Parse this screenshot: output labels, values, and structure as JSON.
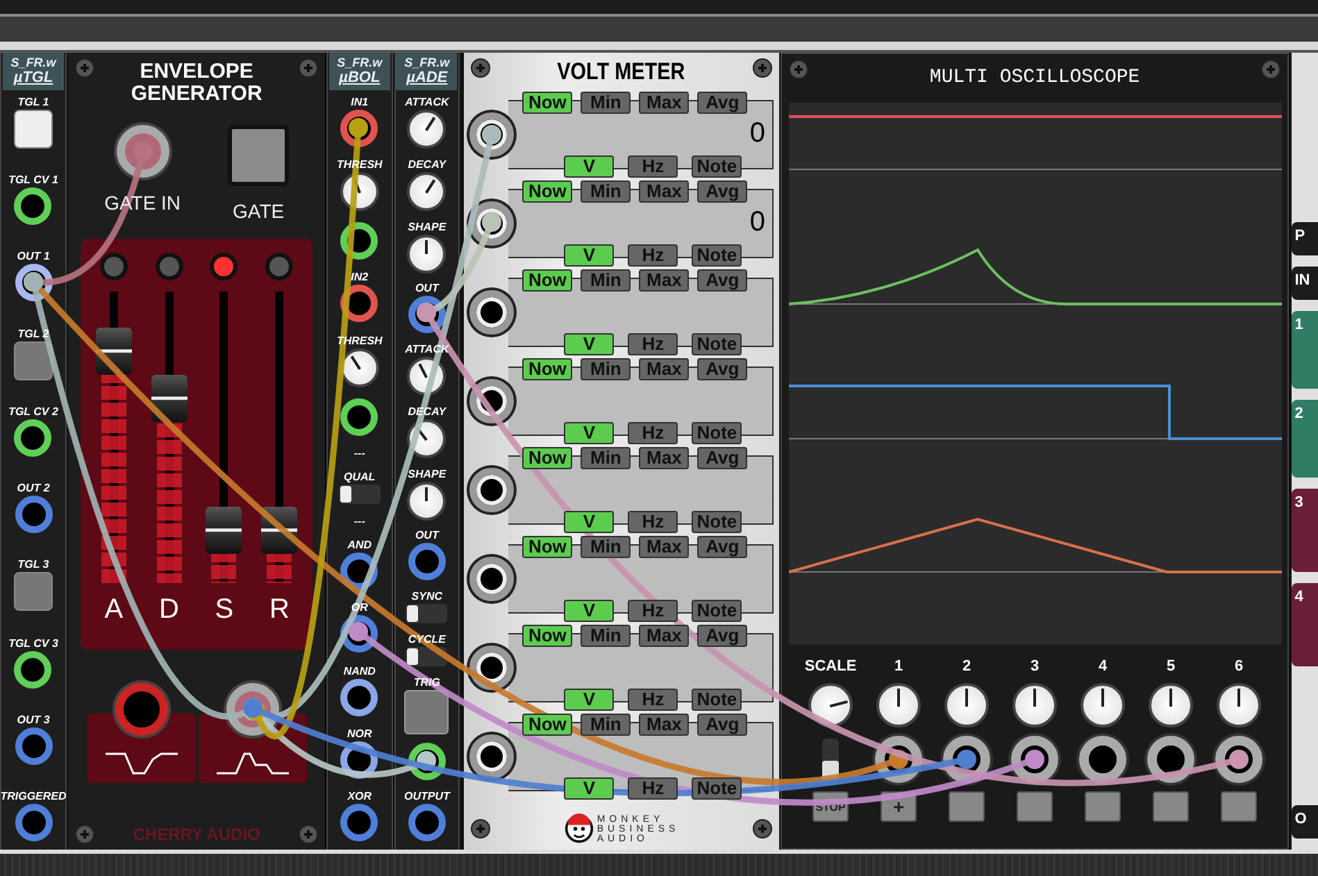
{
  "utgl": {
    "brand": "S_FR.w",
    "name": "µTGL",
    "items": [
      {
        "label": "TGL 1",
        "kind": "toggle",
        "on": true
      },
      {
        "label": "TGL CV 1",
        "kind": "jack",
        "color": "#5fcf57"
      },
      {
        "label": "OUT 1",
        "kind": "jack",
        "color": "#a9b8ef"
      },
      {
        "label": "TGL 2",
        "kind": "toggle",
        "on": false
      },
      {
        "label": "TGL CV 2",
        "kind": "jack",
        "color": "#5fcf57"
      },
      {
        "label": "OUT 2",
        "kind": "jack",
        "color": "#4f7fd9"
      },
      {
        "label": "TGL 3",
        "kind": "toggle",
        "on": false
      },
      {
        "label": "TGL CV 3",
        "kind": "jack",
        "color": "#5fcf57"
      },
      {
        "label": "OUT 3",
        "kind": "jack",
        "color": "#4f7fd9"
      },
      {
        "label": "TRIGGERED",
        "kind": "jack",
        "color": "#4f7fd9"
      }
    ]
  },
  "envelope": {
    "title": "ENVELOPE GENERATOR",
    "gate_in": "GATE IN",
    "gate": "GATE",
    "brand": "CHERRY AUDIO",
    "faders": [
      {
        "label": "A",
        "level": 0.85,
        "lit": false
      },
      {
        "label": "D",
        "level": 0.66,
        "lit": false
      },
      {
        "label": "S",
        "level": 0.12,
        "lit": true
      },
      {
        "label": "R",
        "level": 0.12,
        "lit": false
      }
    ]
  },
  "ubol": {
    "brand": "S_FR.w",
    "name": "µBOL",
    "items": [
      {
        "label": "IN1",
        "kind": "jack",
        "color": "#e0544e"
      },
      {
        "label": "THRESH",
        "kind": "knob",
        "level": 0.42
      },
      {
        "kind": "jack",
        "color": "#5fcf57"
      },
      {
        "label": "IN2",
        "kind": "jack",
        "color": "#e0544e"
      },
      {
        "label": "THRESH",
        "kind": "knob",
        "level": 0.38
      },
      {
        "kind": "jack",
        "color": "#5fcf57"
      },
      {
        "label": "---",
        "kind": "text"
      },
      {
        "label": "QUAL",
        "kind": "switch",
        "on": false
      },
      {
        "label": "---",
        "kind": "text"
      },
      {
        "label": "AND",
        "kind": "jack",
        "color": "#4f7fd9"
      },
      {
        "label": "OR",
        "kind": "jack",
        "color": "#4f7fd9"
      },
      {
        "label": "NAND",
        "kind": "jack",
        "color": "#8aa6e8"
      },
      {
        "label": "NOR",
        "kind": "jack",
        "color": "#8aa6e8"
      },
      {
        "label": "XOR",
        "kind": "jack",
        "color": "#4f7fd9"
      }
    ]
  },
  "uade": {
    "brand": "S_FR.w",
    "name": "µADE",
    "items": [
      {
        "label": "ATTACK",
        "kind": "knob",
        "level": 0.62
      },
      {
        "label": "DECAY",
        "kind": "knob",
        "level": 0.62
      },
      {
        "label": "SHAPE",
        "kind": "knob",
        "level": 0.5
      },
      {
        "label": "OUT",
        "kind": "jack",
        "color": "#4f7fd9"
      },
      {
        "label": "ATTACK",
        "kind": "knob",
        "level": 0.4
      },
      {
        "label": "DECAY",
        "kind": "knob",
        "level": 0.36
      },
      {
        "label": "SHAPE",
        "kind": "knob",
        "level": 0.5
      },
      {
        "label": "OUT",
        "kind": "jack",
        "color": "#4f7fd9"
      },
      {
        "label": "SYNC",
        "kind": "switch",
        "on": false
      },
      {
        "label": "CYCLE",
        "kind": "switch",
        "on": false
      },
      {
        "label": "TRIG",
        "kind": "button"
      },
      {
        "kind": "jack",
        "color": "#5fcf57"
      },
      {
        "label": "OUTPUT",
        "kind": "jack",
        "color": "#4f7fd9"
      }
    ]
  },
  "volt_meter": {
    "title": "VOLT METER",
    "logo_lines": [
      "MONKEY",
      "BUSINESS",
      "AUDIO"
    ],
    "rows": [
      {
        "modes": [
          {
            "label": "Now",
            "selected": true
          },
          {
            "label": "Min",
            "selected": false
          },
          {
            "label": "Max",
            "selected": false
          },
          {
            "label": "Avg",
            "selected": false
          }
        ],
        "units": [
          {
            "label": "V",
            "selected": true
          },
          {
            "label": "Hz",
            "selected": false
          },
          {
            "label": "Note",
            "selected": false
          }
        ],
        "reading": "0"
      },
      {
        "modes": [
          {
            "label": "Now",
            "selected": true
          },
          {
            "label": "Min",
            "selected": false
          },
          {
            "label": "Max",
            "selected": false
          },
          {
            "label": "Avg",
            "selected": false
          }
        ],
        "units": [
          {
            "label": "V",
            "selected": true
          },
          {
            "label": "Hz",
            "selected": false
          },
          {
            "label": "Note",
            "selected": false
          }
        ],
        "reading": "0"
      },
      {
        "modes": [
          {
            "label": "Now",
            "selected": true
          },
          {
            "label": "Min",
            "selected": false
          },
          {
            "label": "Max",
            "selected": false
          },
          {
            "label": "Avg",
            "selected": false
          }
        ],
        "units": [
          {
            "label": "V",
            "selected": true
          },
          {
            "label": "Hz",
            "selected": false
          },
          {
            "label": "Note",
            "selected": false
          }
        ]
      },
      {
        "modes": [
          {
            "label": "Now",
            "selected": true
          },
          {
            "label": "Min",
            "selected": false
          },
          {
            "label": "Max",
            "selected": false
          },
          {
            "label": "Avg",
            "selected": false
          }
        ],
        "units": [
          {
            "label": "V",
            "selected": true
          },
          {
            "label": "Hz",
            "selected": false
          },
          {
            "label": "Note",
            "selected": false
          }
        ]
      },
      {
        "modes": [
          {
            "label": "Now",
            "selected": true
          },
          {
            "label": "Min",
            "selected": false
          },
          {
            "label": "Max",
            "selected": false
          },
          {
            "label": "Avg",
            "selected": false
          }
        ],
        "units": [
          {
            "label": "V",
            "selected": true
          },
          {
            "label": "Hz",
            "selected": false
          },
          {
            "label": "Note",
            "selected": false
          }
        ]
      },
      {
        "modes": [
          {
            "label": "Now",
            "selected": true
          },
          {
            "label": "Min",
            "selected": false
          },
          {
            "label": "Max",
            "selected": false
          },
          {
            "label": "Avg",
            "selected": false
          }
        ],
        "units": [
          {
            "label": "V",
            "selected": true
          },
          {
            "label": "Hz",
            "selected": false
          },
          {
            "label": "Note",
            "selected": false
          }
        ]
      },
      {
        "modes": [
          {
            "label": "Now",
            "selected": true
          },
          {
            "label": "Min",
            "selected": false
          },
          {
            "label": "Max",
            "selected": false
          },
          {
            "label": "Avg",
            "selected": false
          }
        ],
        "units": [
          {
            "label": "V",
            "selected": true
          },
          {
            "label": "Hz",
            "selected": false
          },
          {
            "label": "Note",
            "selected": false
          }
        ]
      },
      {
        "modes": [
          {
            "label": "Now",
            "selected": true
          },
          {
            "label": "Min",
            "selected": false
          },
          {
            "label": "Max",
            "selected": false
          },
          {
            "label": "Avg",
            "selected": false
          }
        ],
        "units": [
          {
            "label": "V",
            "selected": true
          },
          {
            "label": "Hz",
            "selected": false
          },
          {
            "label": "Note",
            "selected": false
          }
        ]
      }
    ]
  },
  "oscilloscope": {
    "title": "MULTI OSCILLOSCOPE",
    "scale": {
      "label": "SCALE",
      "level": 0.78
    },
    "run_switch": {
      "on": false
    },
    "stop_button": "STOP",
    "channels": [
      {
        "label": "1",
        "level": 0.5,
        "button": "+"
      },
      {
        "label": "2",
        "level": 0.5
      },
      {
        "label": "3",
        "level": 0.5
      },
      {
        "label": "4",
        "level": 0.5
      },
      {
        "label": "5",
        "level": 0.5
      },
      {
        "label": "6",
        "level": 0.5
      }
    ]
  },
  "edge_module": {
    "items": [
      {
        "label": "P",
        "kind": "dark"
      },
      {
        "label": "IN",
        "kind": "dark"
      },
      {
        "label": "1",
        "kind": "green"
      },
      {
        "label": "2",
        "kind": "green"
      },
      {
        "label": "3",
        "kind": "maroon"
      },
      {
        "label": "4",
        "kind": "maroon"
      },
      {
        "label": "O",
        "kind": "dark"
      }
    ]
  }
}
